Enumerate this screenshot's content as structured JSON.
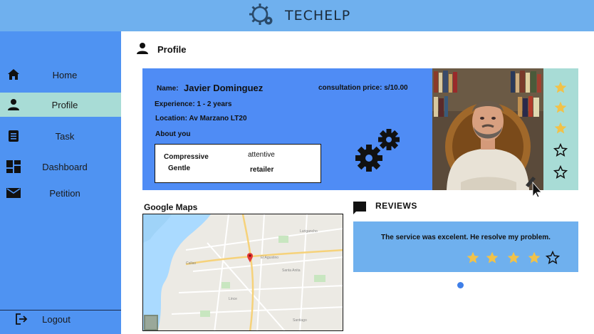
{
  "app": {
    "title": "TECHELP"
  },
  "sidebar": {
    "items": [
      {
        "label": "Home",
        "icon": "home-icon"
      },
      {
        "label": "Profile",
        "icon": "person-icon",
        "active": true
      },
      {
        "label": "Task",
        "icon": "clipboard-icon"
      },
      {
        "label": "Dashboard",
        "icon": "dashboard-icon"
      },
      {
        "label": "Petition",
        "icon": "mail-icon"
      }
    ],
    "logout_label": "Logout"
  },
  "page": {
    "title": "Profile"
  },
  "profile": {
    "name_label": "Name:",
    "name": "Javier Dominguez",
    "price_text": "consultation price: s/10.00",
    "experience": "Experience: 1 - 2 years",
    "location": "Location: Av Marzano LT20",
    "about_label": "About you",
    "traits": [
      "Compressive",
      "attentive",
      "Gentle",
      "retailer"
    ],
    "rating": 3,
    "rating_max": 5
  },
  "maps": {
    "title": "Google Maps"
  },
  "reviews": {
    "title": "REVIEWS",
    "items": [
      {
        "text": "The service was excelent. He resolve my problem.",
        "rating": 4,
        "rating_max": 5
      }
    ]
  },
  "colors": {
    "topbar": "#6fb0ee",
    "sidebar": "#4f93f2",
    "active_item": "#a8dcd6",
    "card": "#4f8cf5",
    "star_filled": "#f0c24a"
  }
}
